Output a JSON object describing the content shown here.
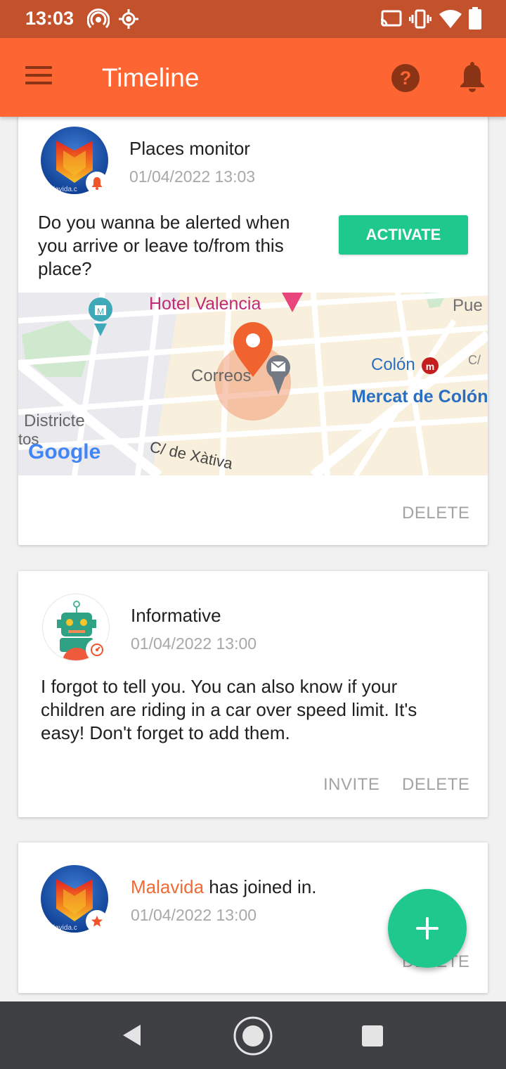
{
  "status_bar": {
    "time": "13:03",
    "left_icons": [
      "hotspot-icon",
      "location-icon"
    ],
    "right_icons": [
      "cast-icon",
      "vibrate-icon",
      "wifi-icon",
      "battery-icon"
    ]
  },
  "app_bar": {
    "title": "Timeline",
    "icons": [
      "menu-icon",
      "help-icon",
      "bell-icon"
    ],
    "color": "#fd6633"
  },
  "cards": [
    {
      "title": "Places monitor",
      "date": "01/04/2022 13:03",
      "text": "Do you wanna be alerted when you arrive or leave to/from this place?",
      "activate_label": "ACTIVATE",
      "delete_label": "DELETE",
      "map": {
        "labels": {
          "hotel": "Hotel Valencia",
          "pue": "Pue",
          "correos": "Correos",
          "colon": "Colón",
          "mercat": "Mercat de Colón",
          "districte": "Districte",
          "tos": "tos",
          "xativa": "C/ de Xàtiva",
          "c_short": "C/"
        },
        "logo": "Google"
      }
    },
    {
      "title": "Informative",
      "date": "01/04/2022 13:00",
      "text": "I forgot to tell you. You can also know if your children are riding in a car over speed limit. It's easy! Don't forget to add them.",
      "invite_label": "INVITE",
      "delete_label": "DELETE"
    },
    {
      "name": "Malavida",
      "title_suffix": " has joined in.",
      "date": "01/04/2022 13:00",
      "delete_label": "DELETE"
    }
  ],
  "avatar_watermark": "malavida.c",
  "fab": {
    "icon": "plus-icon",
    "color": "#1fc98e"
  },
  "nav_bar": {
    "icons": [
      "back-icon",
      "home-icon",
      "recents-icon"
    ]
  }
}
